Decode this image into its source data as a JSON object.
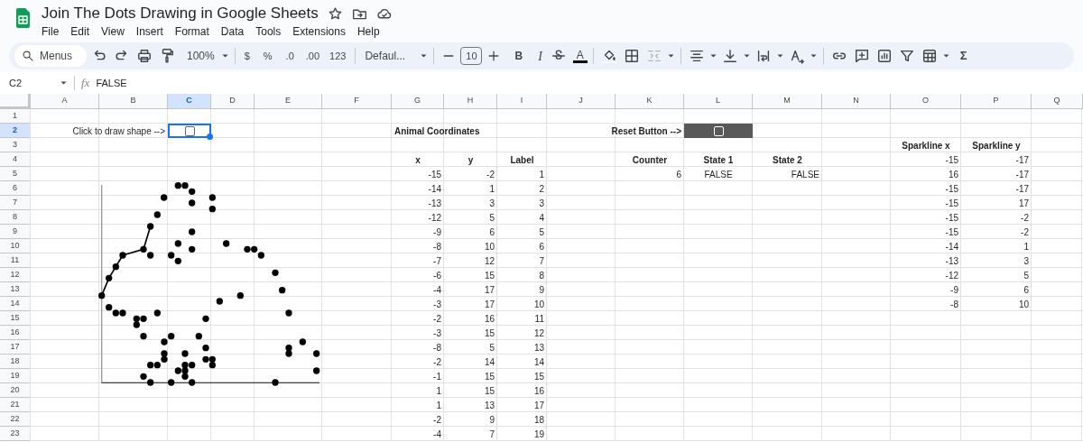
{
  "title": "Join The Dots Drawing in Google Sheets",
  "menu": [
    "File",
    "Edit",
    "View",
    "Insert",
    "Format",
    "Data",
    "Tools",
    "Extensions",
    "Help"
  ],
  "toolbar": {
    "menus": "Menus",
    "zoom": "100%",
    "currency": "$",
    "percent": "%",
    "decimal_decrease": ".0",
    "decimal_increase": ".00",
    "formats": "123",
    "font": "Defaul...",
    "font_size": "10",
    "bold": "B",
    "italic": "I",
    "text_color": "A",
    "functions": "Σ"
  },
  "formula_bar": {
    "name_box": "C2",
    "function_label": "fx",
    "formula": "FALSE"
  },
  "columns": [
    {
      "label": "A",
      "selected": false
    },
    {
      "label": "B",
      "selected": false
    },
    {
      "label": "C",
      "selected": true
    },
    {
      "label": "D",
      "selected": false
    },
    {
      "label": "E",
      "selected": false
    },
    {
      "label": "F",
      "selected": false
    },
    {
      "label": "G",
      "selected": false
    },
    {
      "label": "H",
      "selected": false
    },
    {
      "label": "I",
      "selected": false
    },
    {
      "label": "J",
      "selected": false
    },
    {
      "label": "K",
      "selected": false
    },
    {
      "label": "L",
      "selected": false
    },
    {
      "label": "M",
      "selected": false
    },
    {
      "label": "N",
      "selected": false
    },
    {
      "label": "O",
      "selected": false
    },
    {
      "label": "P",
      "selected": false
    },
    {
      "label": "Q",
      "selected": false
    }
  ],
  "rows": [
    {
      "label": "1",
      "selected": false
    },
    {
      "label": "2",
      "selected": true
    },
    {
      "label": "3",
      "selected": false
    },
    {
      "label": "4",
      "selected": false
    },
    {
      "label": "5",
      "selected": false
    },
    {
      "label": "6",
      "selected": false
    },
    {
      "label": "7",
      "selected": false
    },
    {
      "label": "8",
      "selected": false
    },
    {
      "label": "9",
      "selected": false
    },
    {
      "label": "10",
      "selected": false
    },
    {
      "label": "11",
      "selected": false
    },
    {
      "label": "12",
      "selected": false
    },
    {
      "label": "13",
      "selected": false
    },
    {
      "label": "14",
      "selected": false
    },
    {
      "label": "15",
      "selected": false
    },
    {
      "label": "16",
      "selected": false
    },
    {
      "label": "17",
      "selected": false
    },
    {
      "label": "18",
      "selected": false
    },
    {
      "label": "19",
      "selected": false
    },
    {
      "label": "20",
      "selected": false
    },
    {
      "label": "21",
      "selected": false
    },
    {
      "label": "22",
      "selected": false
    },
    {
      "label": "23",
      "selected": false
    }
  ],
  "prompt": {
    "text": "Click to draw shape -->",
    "checked": false
  },
  "coordinates": {
    "title": "Animal Coordinates",
    "columns": [
      "x",
      "y",
      "Label"
    ],
    "rows": [
      [
        "-15",
        "-2",
        "1"
      ],
      [
        "-14",
        "1",
        "2"
      ],
      [
        "-13",
        "3",
        "3"
      ],
      [
        "-12",
        "5",
        "4"
      ],
      [
        "-9",
        "6",
        "5"
      ],
      [
        "-8",
        "10",
        "6"
      ],
      [
        "-7",
        "12",
        "7"
      ],
      [
        "-6",
        "15",
        "8"
      ],
      [
        "-4",
        "17",
        "9"
      ],
      [
        "-3",
        "17",
        "10"
      ],
      [
        "-2",
        "16",
        "11"
      ],
      [
        "-3",
        "15",
        "12"
      ],
      [
        "-8",
        "5",
        "13"
      ],
      [
        "-2",
        "14",
        "14"
      ],
      [
        "-1",
        "15",
        "15"
      ],
      [
        "1",
        "15",
        "16"
      ],
      [
        "1",
        "13",
        "17"
      ],
      [
        "-2",
        "9",
        "18"
      ],
      [
        "-4",
        "7",
        "19"
      ]
    ]
  },
  "reset": {
    "text": "Reset Button -->",
    "checked": false
  },
  "state": {
    "columns": [
      "Counter",
      "State 1",
      "State 2"
    ],
    "values": [
      "6",
      "FALSE",
      "FALSE"
    ]
  },
  "sparkline_table": {
    "columns": [
      "Sparkline x",
      "Sparkline y"
    ],
    "rows": [
      [
        "-15",
        "-17"
      ],
      [
        "16",
        "-17"
      ],
      [
        "-15",
        "-17"
      ],
      [
        "-15",
        "17"
      ],
      [
        "-15",
        "-2"
      ],
      [
        "-15",
        "-2"
      ],
      [
        "-14",
        "1"
      ],
      [
        "-13",
        "3"
      ],
      [
        "-12",
        "5"
      ],
      [
        "-9",
        "6"
      ],
      [
        "-8",
        "10"
      ]
    ]
  }
}
